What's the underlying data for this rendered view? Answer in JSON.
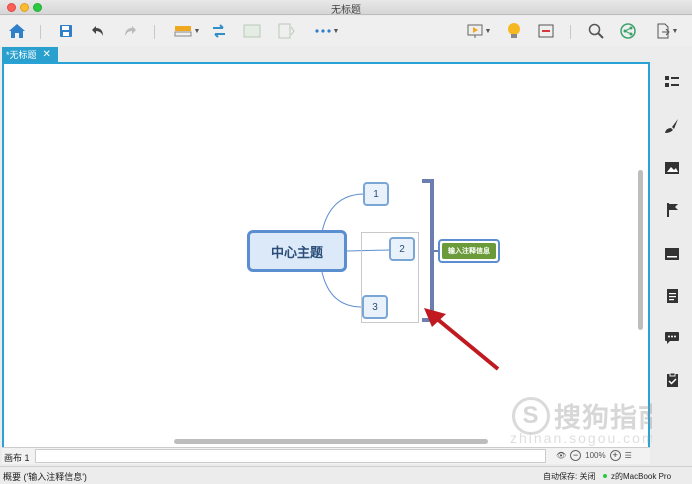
{
  "window": {
    "title": "无标题"
  },
  "tabs": [
    {
      "label": "*无标题",
      "close_glyph": "✕"
    }
  ],
  "toolbar": {
    "icons": [
      "home-icon",
      "save-icon",
      "undo-icon",
      "redo-icon",
      "insert-topic-icon",
      "relationship-icon",
      "summary-icon",
      "boundary-icon",
      "more-icon",
      "presentation-icon",
      "idea-icon",
      "outline-icon",
      "search-icon",
      "share-icon",
      "export-icon"
    ]
  },
  "mindmap": {
    "central_topic": "中心主题",
    "subtopics": [
      "1",
      "2",
      "3"
    ],
    "summary_topic": "输入注释信息",
    "colors": {
      "topic_border": "#5b8ed0",
      "summary_bracket": "#6a7fb0",
      "summary_fill": "#6a9a3a",
      "arrow": "#c0191f"
    }
  },
  "sheet": {
    "label": "画布 1",
    "zoom": "100%"
  },
  "status": {
    "left": "概要 ('输入注释信息')",
    "autosave": "自动保存: 关闭",
    "device": "z的MacBook Pro"
  },
  "watermark": {
    "text": "搜狗指南",
    "glyph": "S",
    "url": "zhinan.sogou.com"
  },
  "right_panel": {
    "icons": [
      "format-list-icon",
      "brush-icon",
      "image-icon",
      "flag-icon",
      "text-icon",
      "note-icon",
      "comment-icon",
      "task-icon"
    ]
  }
}
